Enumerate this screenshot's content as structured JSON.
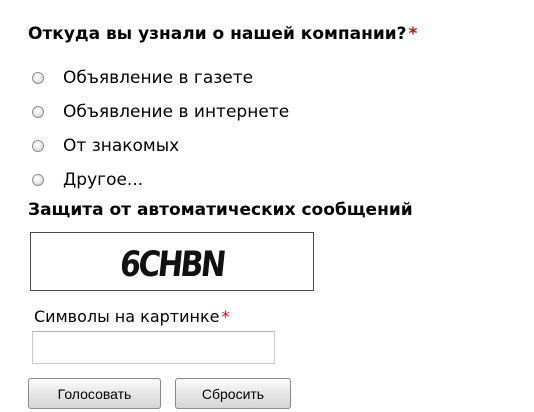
{
  "survey": {
    "question": "Откуда вы узнали о нашей компании?",
    "required_mark": "*",
    "options": [
      {
        "label": "Объявление в газете",
        "selected": false
      },
      {
        "label": "Объявление в интернете",
        "selected": false
      },
      {
        "label": "От знакомых",
        "selected": false
      },
      {
        "label": "Другое...",
        "selected": false
      }
    ]
  },
  "captcha": {
    "title": "Защита от автоматических сообщений",
    "image_text": "6CHBN",
    "field_label": "Символы на картинке",
    "required_mark": "*",
    "value": "",
    "placeholder": ""
  },
  "buttons": {
    "submit_label": "Голосовать",
    "reset_label": "Сбросить"
  },
  "colors": {
    "required": "#ee0000"
  }
}
